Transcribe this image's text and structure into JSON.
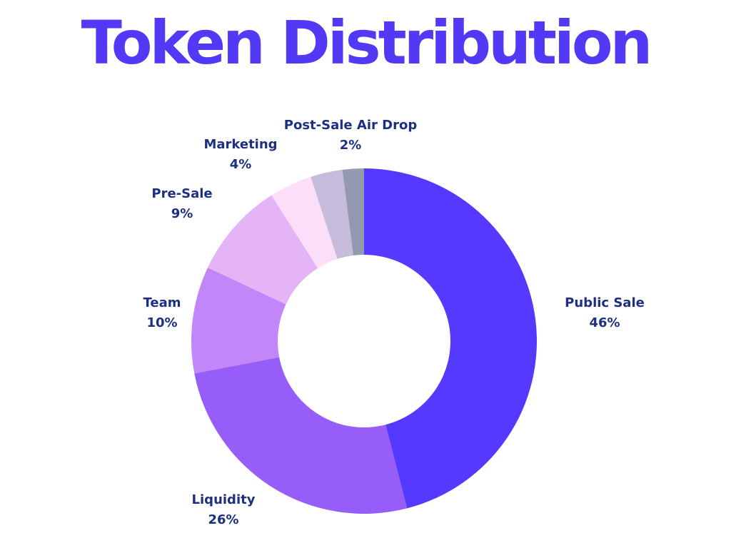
{
  "title": "Token Distribution",
  "chart_data": {
    "type": "pie",
    "title": "Token Distribution",
    "slices": [
      {
        "label": "Public Sale",
        "value": 46,
        "display": "46%",
        "color": "#5539fe"
      },
      {
        "label": "Liquidity",
        "value": 26,
        "display": "26%",
        "color": "#965df8"
      },
      {
        "label": "Team",
        "value": 10,
        "display": "10%",
        "color": "#c386f8"
      },
      {
        "label": "Pre-Sale",
        "value": 9,
        "display": "9%",
        "color": "#e4b4f7"
      },
      {
        "label": "Marketing",
        "value": 4,
        "display": "4%",
        "color": "#fbdff9"
      },
      {
        "label": "",
        "value": 3,
        "display": "",
        "color": "#c7bbdb"
      },
      {
        "label": "Post-Sale Air Drop",
        "value": 2,
        "display": "2%",
        "color": "#939aaf"
      }
    ],
    "style": "donut",
    "start_angle": "top",
    "direction": "clockwise"
  }
}
